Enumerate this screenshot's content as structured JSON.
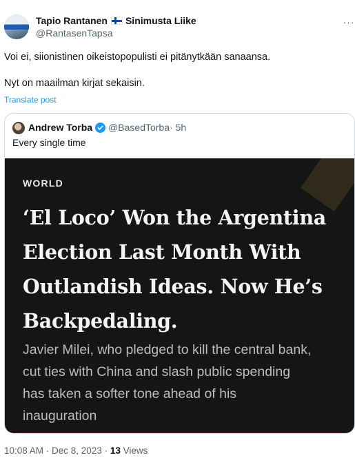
{
  "tweet": {
    "author_name": "Tapio Rantanen",
    "author_suffix": "Sinimusta Liike",
    "author_flag": "finland-flag-icon",
    "handle": "@RantasenTapsa",
    "more_icon": "more-horizontal-icon",
    "more_label": "···",
    "text_line1": "Voi ei, siionistinen oikeistopopulisti ei pitänytkään sanaansa.",
    "text_line2": "Nyt on maailman kirjat sekaisin.",
    "translate_label": "Translate post",
    "time": "10:08 AM · Dec 8, 2023 · ",
    "views_count": "13",
    "views_label": " Views"
  },
  "quote": {
    "author_name": "Andrew Torba",
    "verified_icon": "verified-badge-icon",
    "handle": "@BasedTorba",
    "time": " · 5h",
    "text": "Every single time",
    "media": {
      "section": "WORLD",
      "headline_lines": [
        "‘El Loco’ Won the Argentina",
        "Election Last Month With",
        "Outlandish Ideas. Now He’s",
        "Backpedaling."
      ],
      "dek_lines": [
        "Javier Milei, who pledged to kill the central bank,",
        "cut ties with China and slash public spending",
        "has taken a softer tone ahead of his",
        "inauguration"
      ]
    }
  },
  "colors": {
    "accent": "#1d9bf0",
    "secondary_text": "#536471",
    "border": "#cfd9de",
    "media_background": "#151515"
  }
}
